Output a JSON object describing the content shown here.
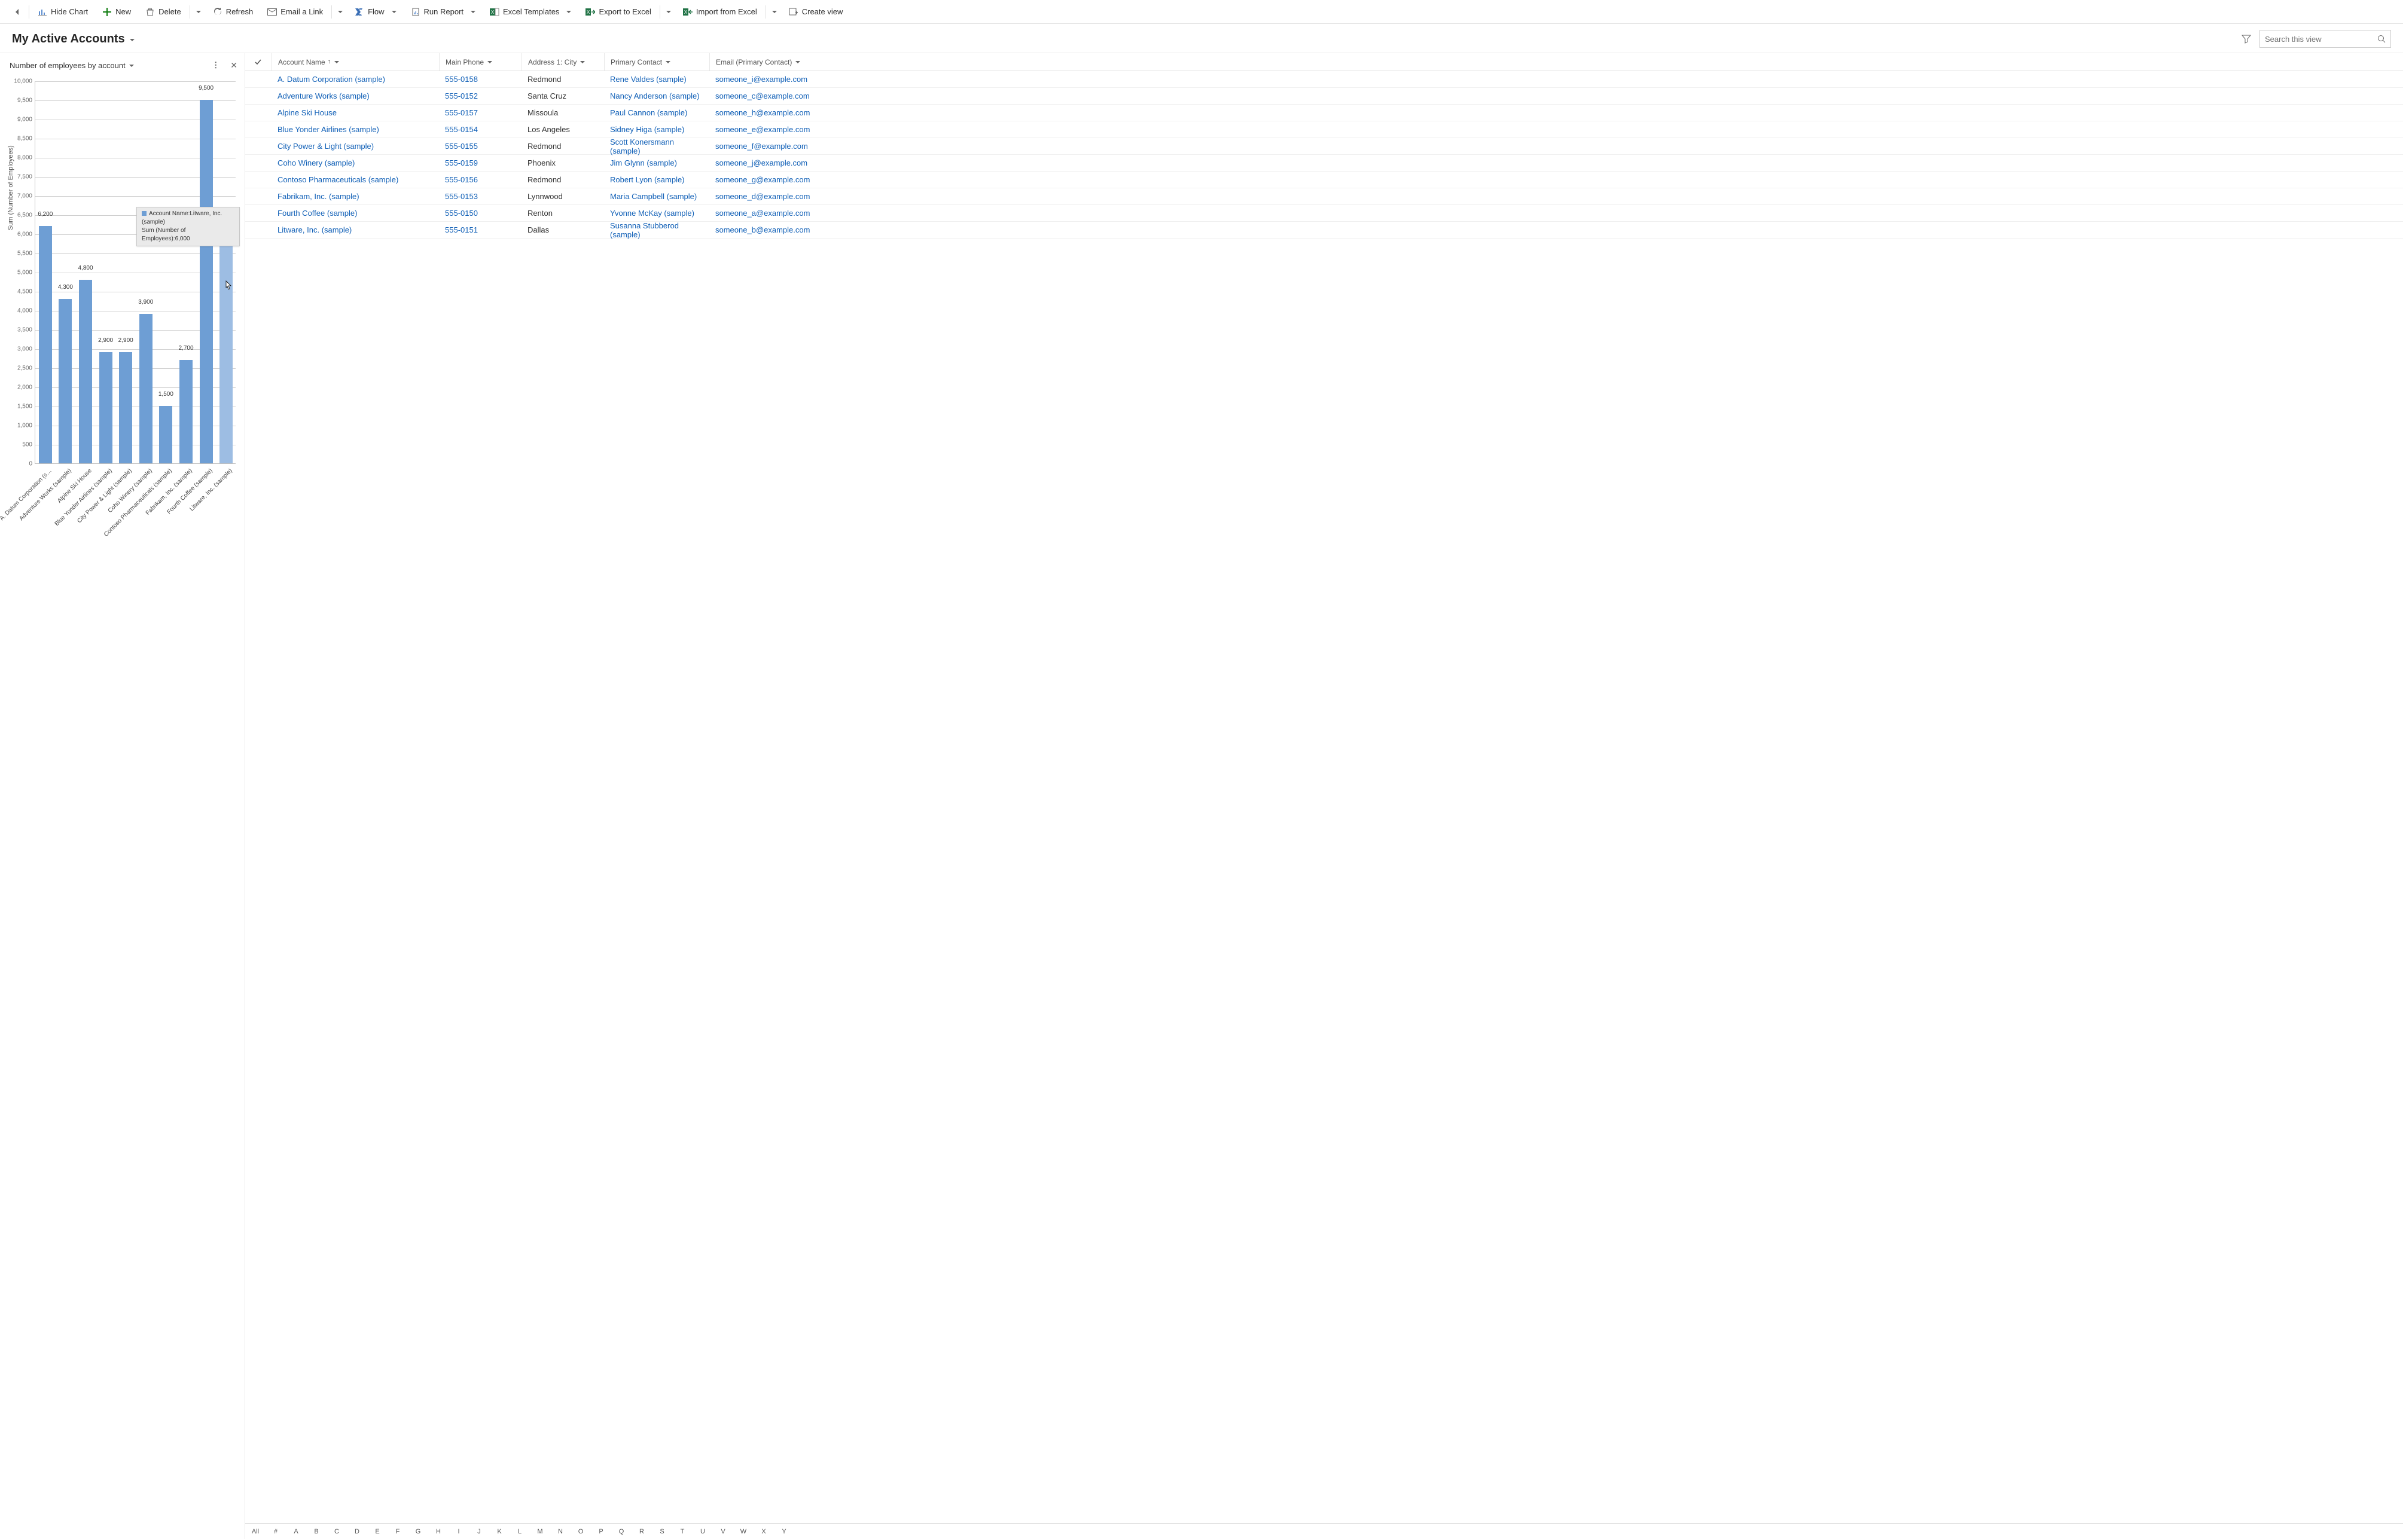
{
  "toolbar": {
    "back": "",
    "hide_chart": "Hide Chart",
    "new": "New",
    "delete": "Delete",
    "refresh": "Refresh",
    "email_link": "Email a Link",
    "flow": "Flow",
    "run_report": "Run Report",
    "excel_templates": "Excel Templates",
    "export_excel": "Export to Excel",
    "import_excel": "Import from Excel",
    "create_view": "Create view"
  },
  "header": {
    "view_title": "My Active Accounts",
    "search_placeholder": "Search this view"
  },
  "chart": {
    "title": "Number of employees by account",
    "y_axis_label": "Sum (Number of Employees)",
    "tooltip_line1": "Account Name:Litware, Inc. (sample)",
    "tooltip_line2": "Sum (Number of Employees):6,000"
  },
  "chart_data": {
    "type": "bar",
    "title": "Number of employees by account",
    "xlabel": "",
    "ylabel": "Sum (Number of Employees)",
    "ylim": [
      0,
      10000
    ],
    "ytick_step": 500,
    "categories": [
      "A. Datum Corporation (s…",
      "Adventure Works (sample)",
      "Alpine Ski House",
      "Blue Yonder Airlines (sample)",
      "City Power & Light (sample)",
      "Coho Winery (sample)",
      "Contoso Pharmaceuticals (sample)",
      "Fabrikam, Inc. (sample)",
      "Fourth Coffee (sample)",
      "Litware, Inc. (sample)"
    ],
    "values": [
      6200,
      4300,
      4800,
      2900,
      2900,
      3900,
      1500,
      2700,
      9500,
      6000
    ],
    "value_labels": [
      "6,200",
      "4,300",
      "4,800",
      "2,900",
      "2,900",
      "3,900",
      "1,500",
      "2,700",
      "9,500",
      "6,000"
    ],
    "highlight_index": 9
  },
  "grid": {
    "columns": {
      "name": "Account Name",
      "phone": "Main Phone",
      "city": "Address 1: City",
      "contact": "Primary Contact",
      "email": "Email (Primary Contact)"
    },
    "rows": [
      {
        "name": "A. Datum Corporation (sample)",
        "phone": "555-0158",
        "city": "Redmond",
        "contact": "Rene Valdes (sample)",
        "email": "someone_i@example.com"
      },
      {
        "name": "Adventure Works (sample)",
        "phone": "555-0152",
        "city": "Santa Cruz",
        "contact": "Nancy Anderson (sample)",
        "email": "someone_c@example.com"
      },
      {
        "name": "Alpine Ski House",
        "phone": "555-0157",
        "city": "Missoula",
        "contact": "Paul Cannon (sample)",
        "email": "someone_h@example.com"
      },
      {
        "name": "Blue Yonder Airlines (sample)",
        "phone": "555-0154",
        "city": "Los Angeles",
        "contact": "Sidney Higa (sample)",
        "email": "someone_e@example.com"
      },
      {
        "name": "City Power & Light (sample)",
        "phone": "555-0155",
        "city": "Redmond",
        "contact": "Scott Konersmann (sample)",
        "email": "someone_f@example.com"
      },
      {
        "name": "Coho Winery (sample)",
        "phone": "555-0159",
        "city": "Phoenix",
        "contact": "Jim Glynn (sample)",
        "email": "someone_j@example.com"
      },
      {
        "name": "Contoso Pharmaceuticals (sample)",
        "phone": "555-0156",
        "city": "Redmond",
        "contact": "Robert Lyon (sample)",
        "email": "someone_g@example.com"
      },
      {
        "name": "Fabrikam, Inc. (sample)",
        "phone": "555-0153",
        "city": "Lynnwood",
        "contact": "Maria Campbell (sample)",
        "email": "someone_d@example.com"
      },
      {
        "name": "Fourth Coffee (sample)",
        "phone": "555-0150",
        "city": "Renton",
        "contact": "Yvonne McKay (sample)",
        "email": "someone_a@example.com"
      },
      {
        "name": "Litware, Inc. (sample)",
        "phone": "555-0151",
        "city": "Dallas",
        "contact": "Susanna Stubberod (sample)",
        "email": "someone_b@example.com"
      }
    ]
  },
  "alpha": [
    "All",
    "#",
    "A",
    "B",
    "C",
    "D",
    "E",
    "F",
    "G",
    "H",
    "I",
    "J",
    "K",
    "L",
    "M",
    "N",
    "O",
    "P",
    "Q",
    "R",
    "S",
    "T",
    "U",
    "V",
    "W",
    "X",
    "Y"
  ]
}
